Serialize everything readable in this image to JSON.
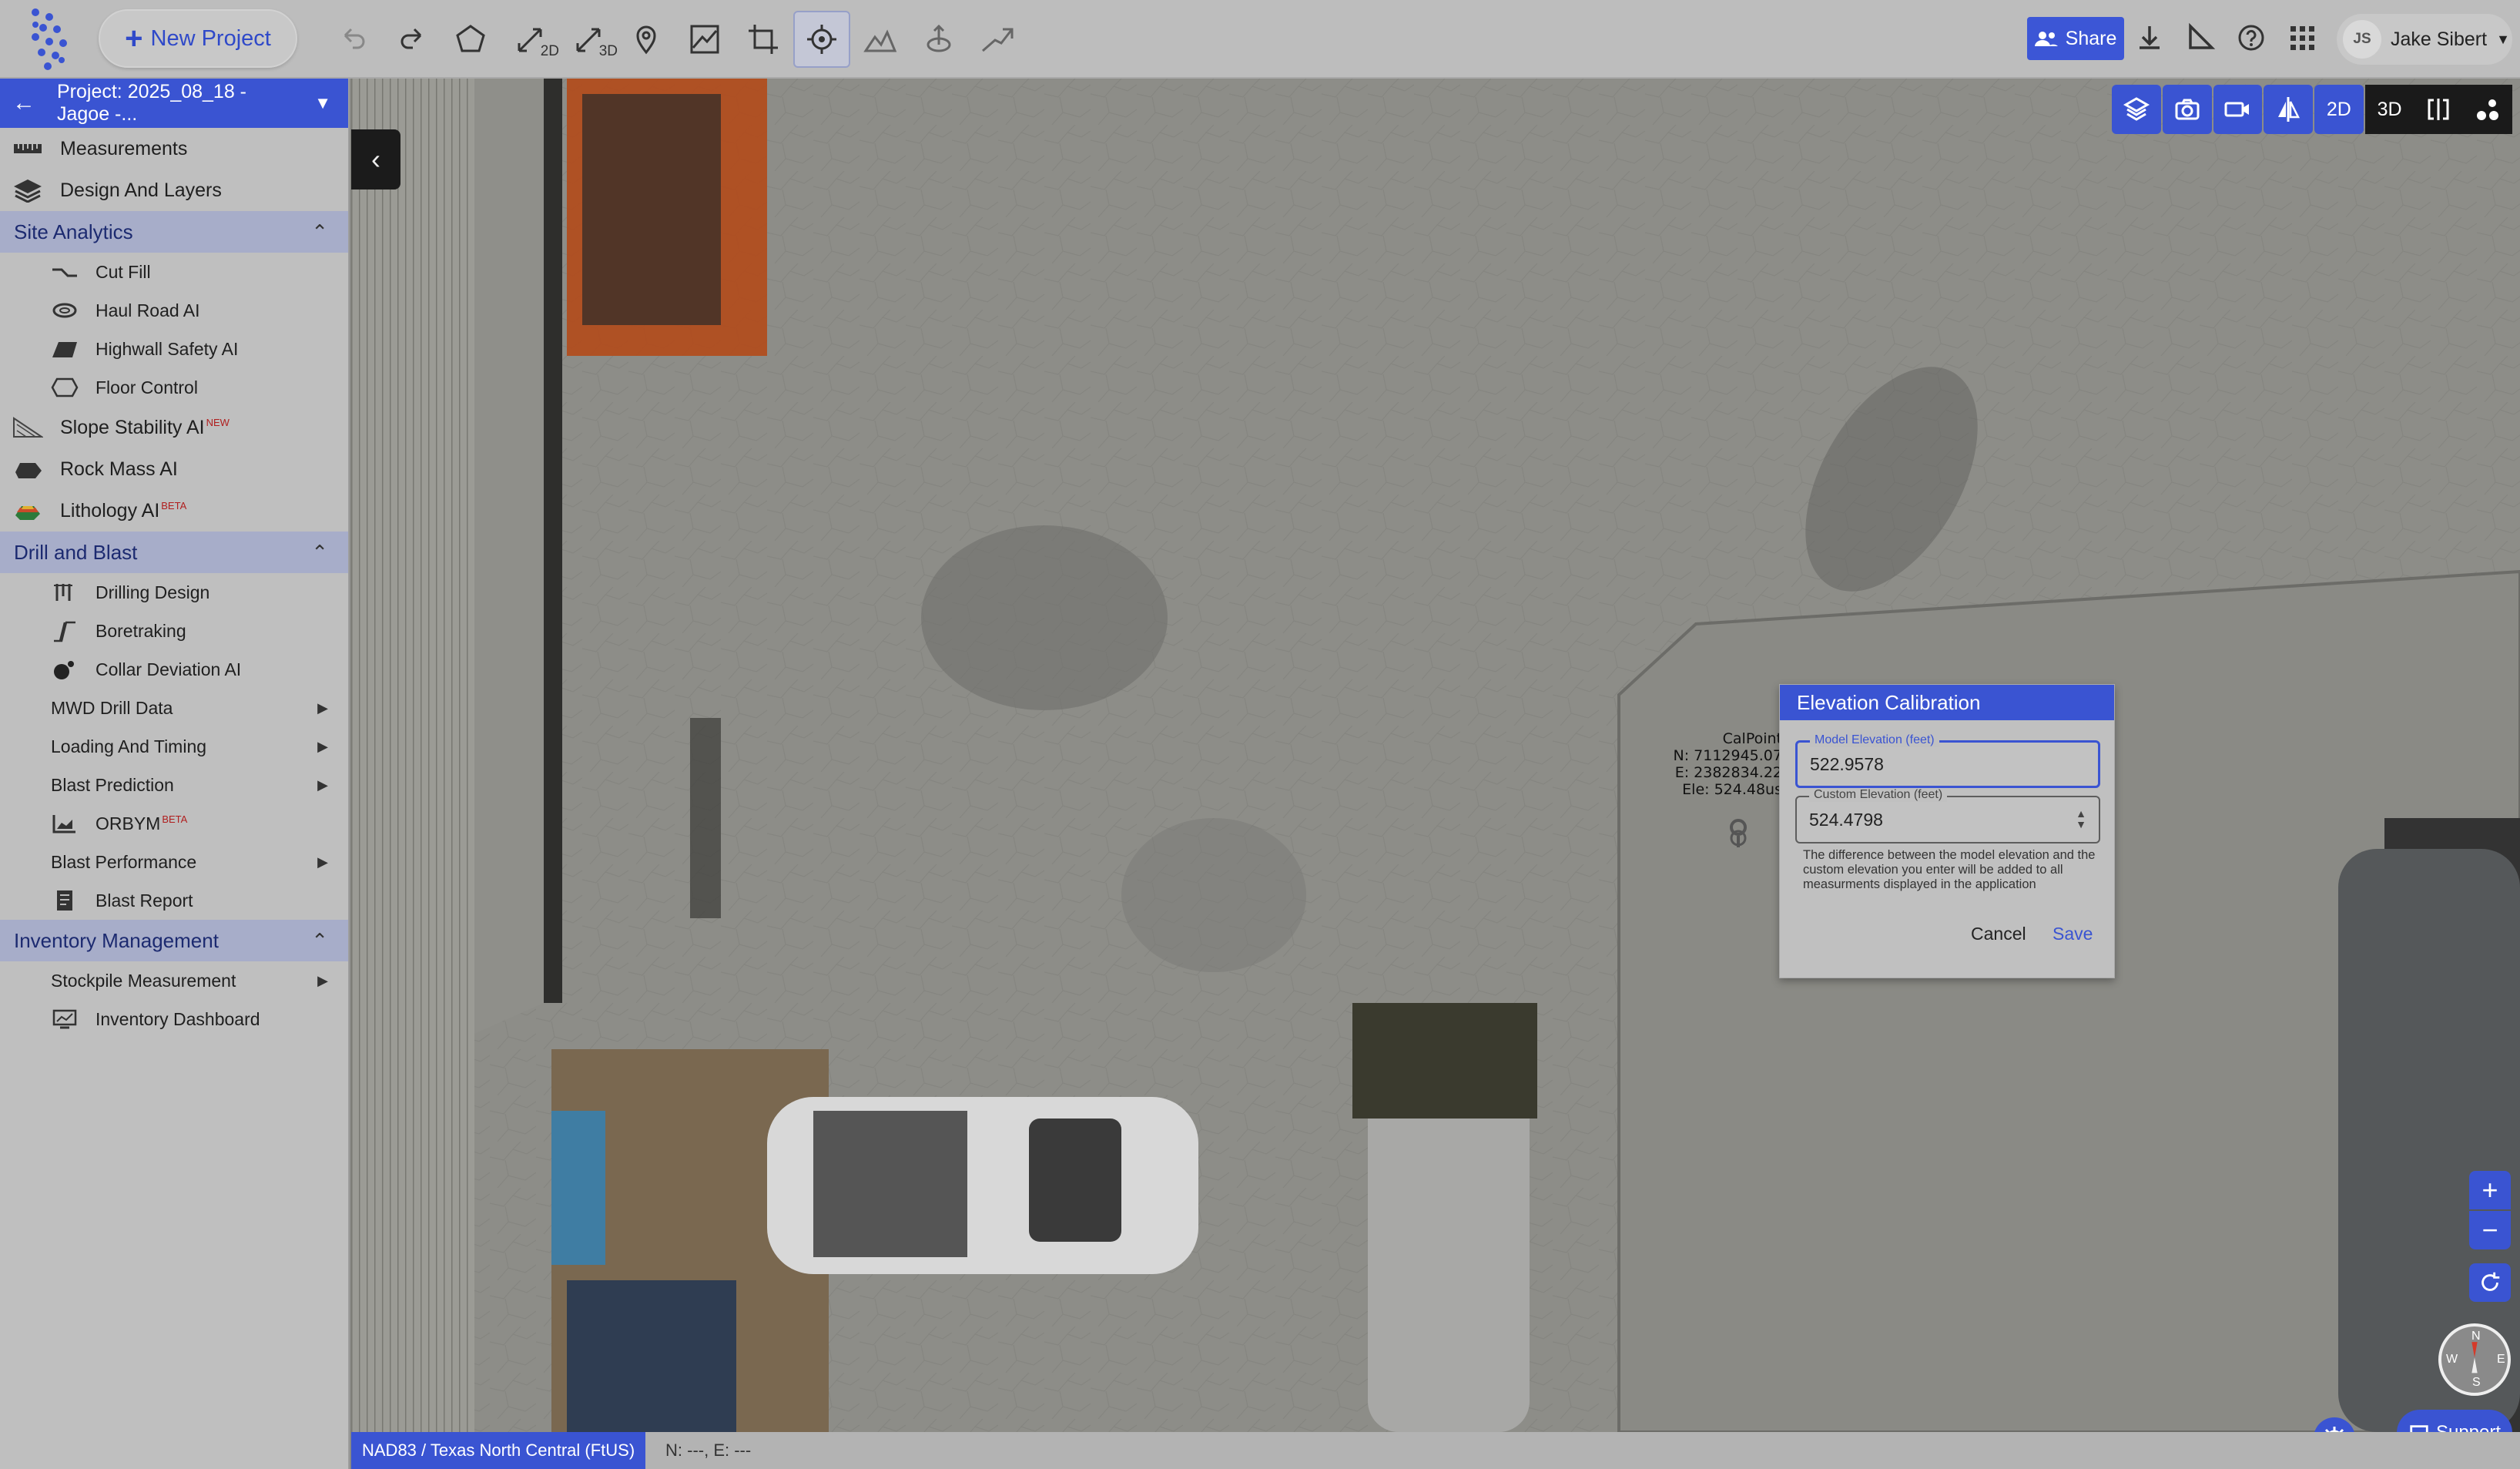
{
  "toolbar": {
    "new_project_label": "New Project",
    "sub_2d": "2D",
    "sub_3d": "3D",
    "share_label": "Share",
    "user_initials": "JS",
    "user_name": "Jake Sibert"
  },
  "sidebar": {
    "project_label": "Project: 2025_08_18 - Jagoe -...",
    "items": [
      {
        "label": "Measurements"
      },
      {
        "label": "Design And Layers"
      }
    ],
    "site_analytics": {
      "title": "Site Analytics",
      "items": [
        {
          "label": "Cut Fill"
        },
        {
          "label": "Haul Road AI"
        },
        {
          "label": "Highwall Safety AI"
        },
        {
          "label": "Floor Control"
        },
        {
          "label": "Slope Stability AI",
          "tag": "NEW"
        },
        {
          "label": "Rock Mass AI"
        },
        {
          "label": "Lithology AI",
          "tag": "BETA"
        }
      ]
    },
    "drill_blast": {
      "title": "Drill and Blast",
      "items": [
        {
          "label": "Drilling Design"
        },
        {
          "label": "Boretraking"
        },
        {
          "label": "Collar Deviation AI"
        },
        {
          "label": "MWD Drill Data"
        },
        {
          "label": "Loading And Timing"
        },
        {
          "label": "Blast Prediction"
        },
        {
          "label": "ORBYM",
          "tag": "BETA"
        },
        {
          "label": "Blast Performance"
        },
        {
          "label": "Blast Report"
        }
      ]
    },
    "inventory": {
      "title": "Inventory Management",
      "items": [
        {
          "label": "Stockpile Measurement"
        },
        {
          "label": "Inventory Dashboard"
        }
      ]
    }
  },
  "viewbar": {
    "label_2d": "2D",
    "label_3d": "3D"
  },
  "calpoint": {
    "name": "CalPoint",
    "north": "N: 7112945.07",
    "east": "E: 2382834.22",
    "elev": "Ele: 524.48us"
  },
  "dialog": {
    "title": "Elevation Calibration",
    "model_label": "Model Elevation (feet)",
    "model_value": "522.9578",
    "custom_label": "Custom Elevation (feet)",
    "custom_value": "524.4798",
    "note": "The difference between the model elevation and the custom elevation you enter will be added to all measurments displayed in the application",
    "cancel": "Cancel",
    "save": "Save"
  },
  "controls": {
    "zoom_in": "+",
    "zoom_out": "−",
    "support": "Support",
    "compass": {
      "n": "N",
      "s": "S",
      "e": "E",
      "w": "W"
    }
  },
  "status": {
    "crs": "NAD83 / Texas North Central (FtUS)",
    "coords": "N: ---, E: ---"
  },
  "colors": {
    "accent": "#3a54d2"
  }
}
